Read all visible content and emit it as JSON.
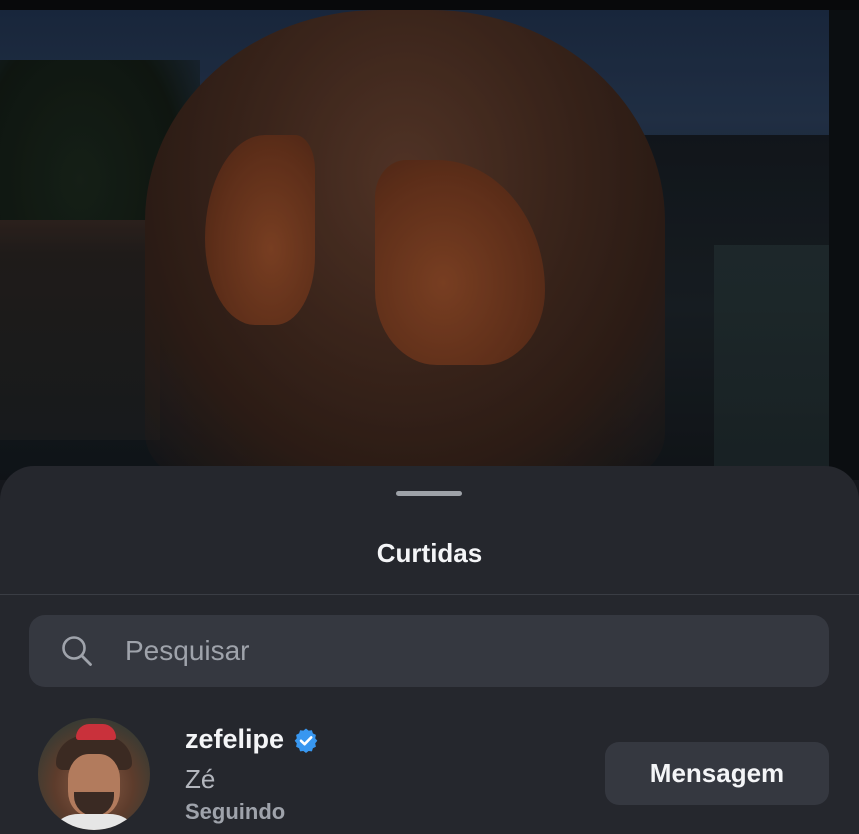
{
  "sheet": {
    "title": "Curtidas"
  },
  "search": {
    "placeholder": "Pesquisar",
    "icon": "search-icon"
  },
  "likes": [
    {
      "username": "zefelipe",
      "verified": true,
      "full_name": "Zé",
      "status": "Seguindo",
      "action_label": "Mensagem"
    }
  ],
  "colors": {
    "sheet_background": "#25272d",
    "input_background": "#353840",
    "verified_badge": "#3897f0",
    "text_primary": "#f4f5f7",
    "text_secondary": "#9fa3ab"
  }
}
